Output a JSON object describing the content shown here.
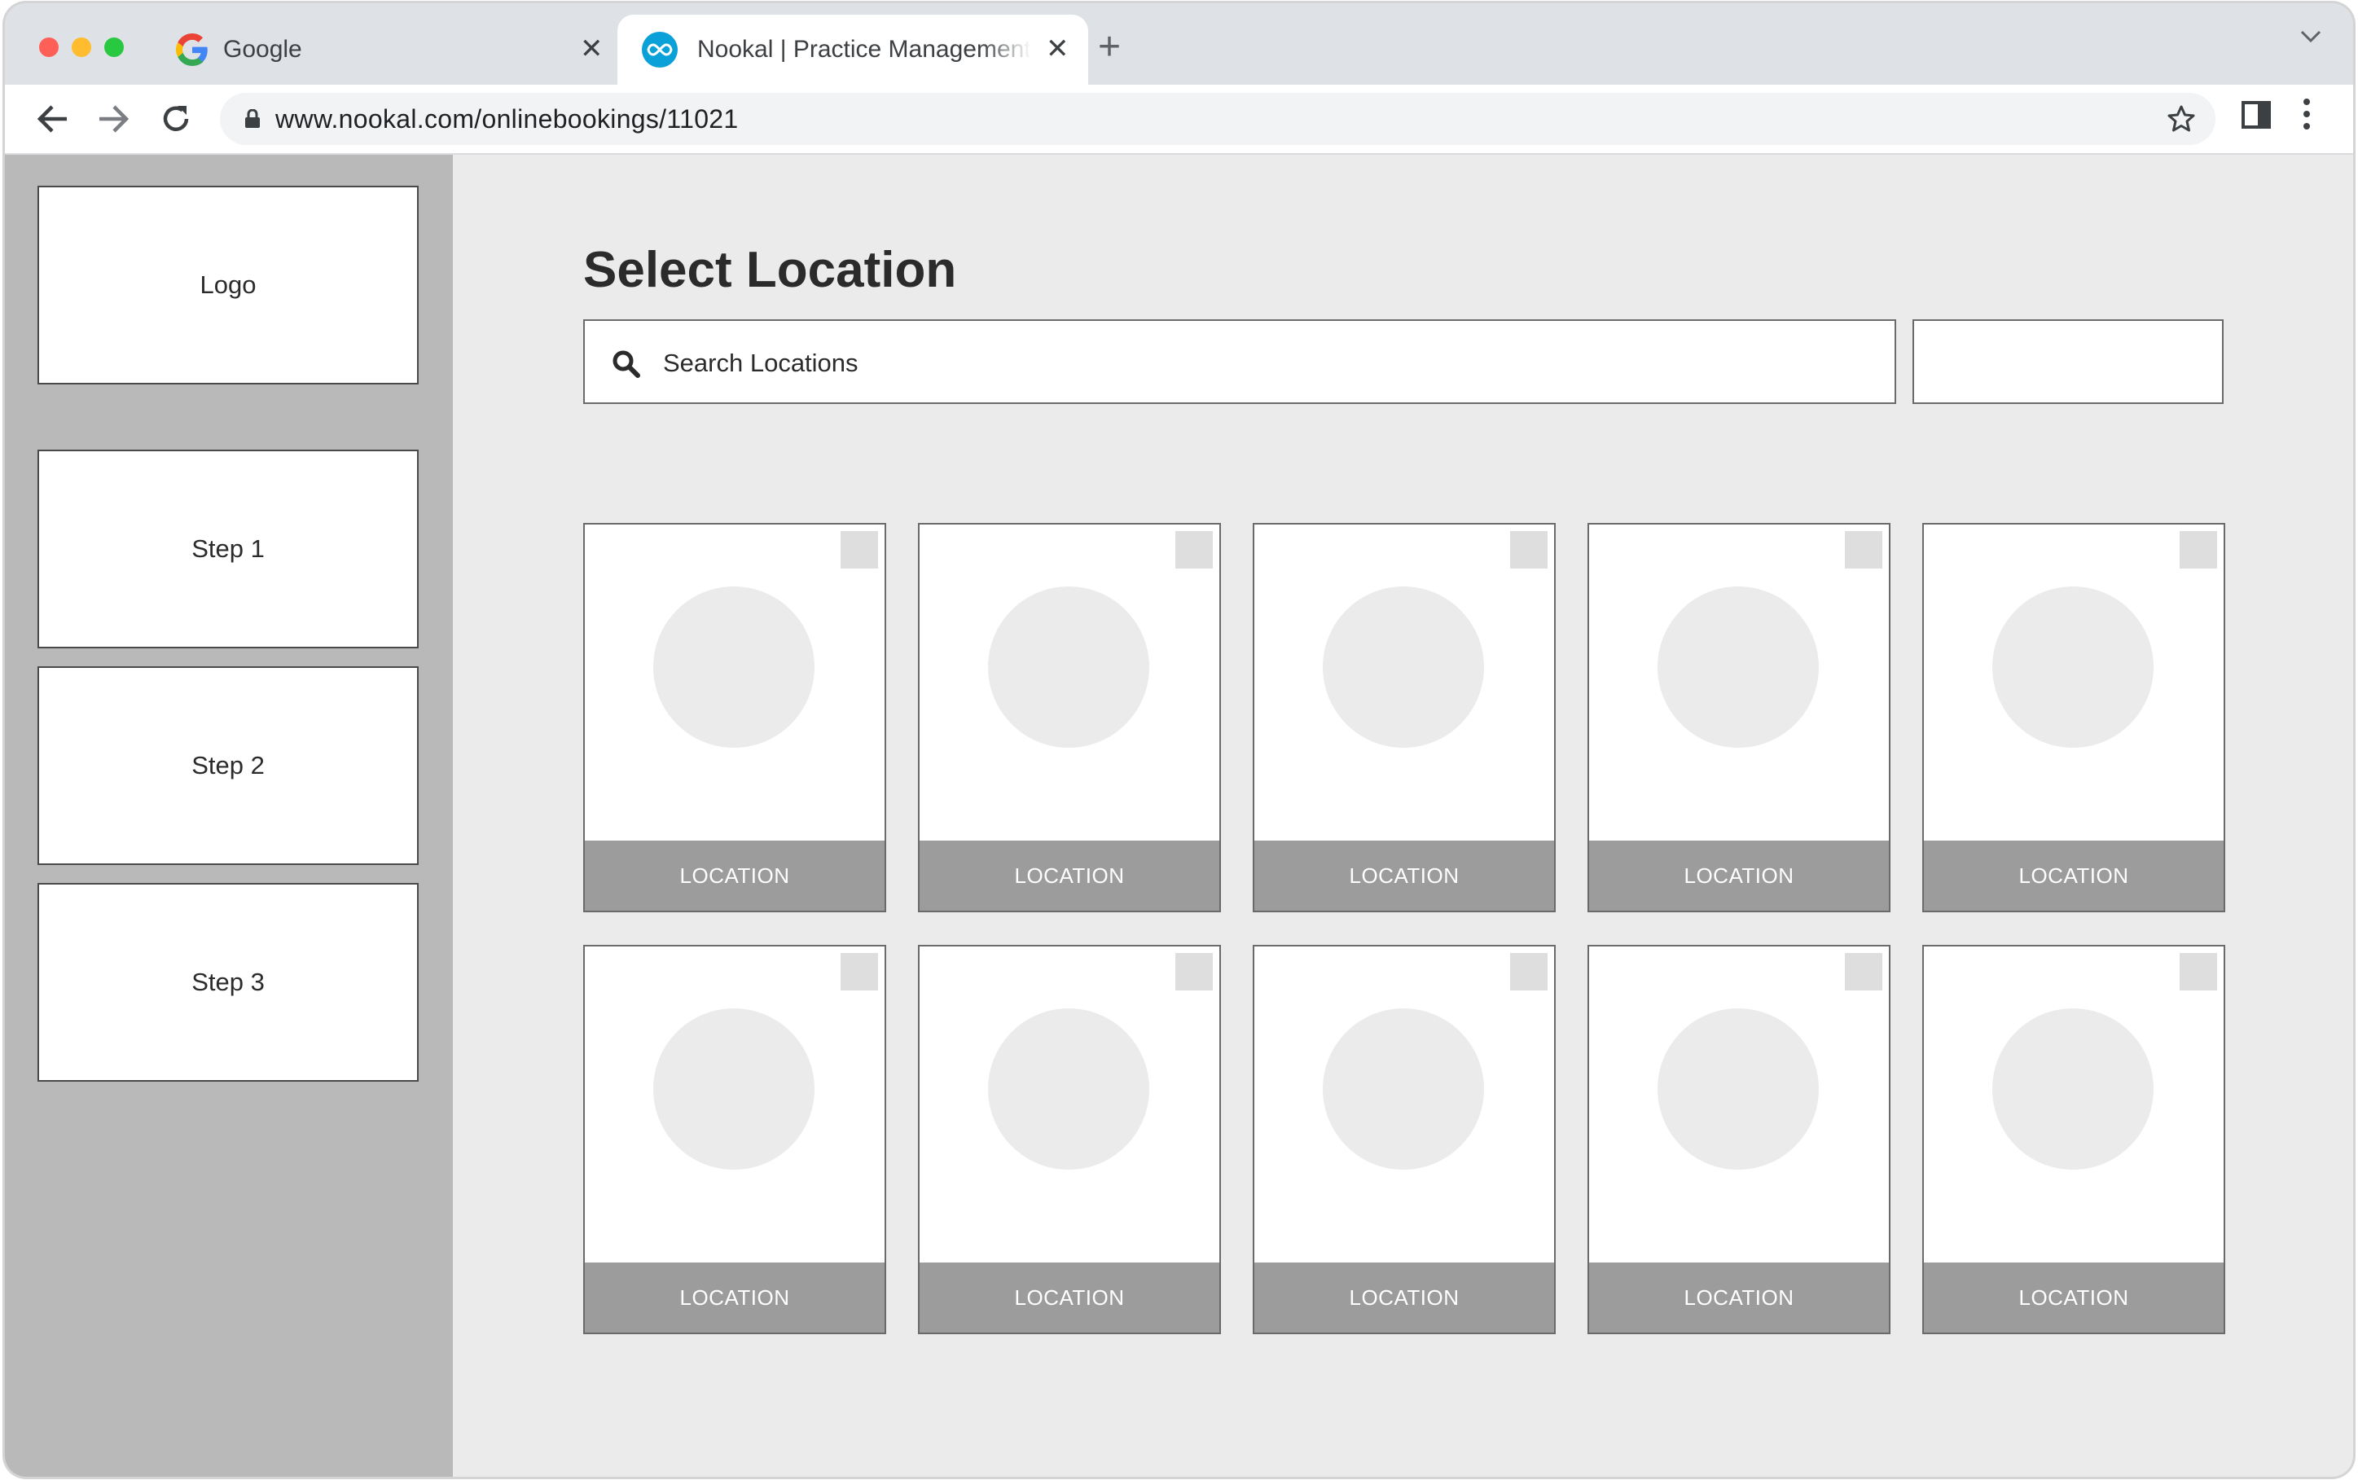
{
  "browser": {
    "tabs": [
      {
        "title": "Google",
        "active": false,
        "icon": "google-icon"
      },
      {
        "title": "Nookal | Practice Management",
        "active": true,
        "icon": "nookal-icon"
      }
    ],
    "url": "www.nookal.com/onlinebookings/11021"
  },
  "sidebar": {
    "logo": "Logo",
    "steps": [
      "Step 1",
      "Step 2",
      "Step 3"
    ]
  },
  "main": {
    "title": "Select Location",
    "search": {
      "placeholder": "Search Locations"
    },
    "filter": {
      "value": ""
    },
    "locations": [
      {
        "label": "LOCATION"
      },
      {
        "label": "LOCATION"
      },
      {
        "label": "LOCATION"
      },
      {
        "label": "LOCATION"
      },
      {
        "label": "LOCATION"
      },
      {
        "label": "LOCATION"
      },
      {
        "label": "LOCATION"
      },
      {
        "label": "LOCATION"
      },
      {
        "label": "LOCATION"
      },
      {
        "label": "LOCATION"
      }
    ]
  },
  "colors": {
    "sidebar": "#b9b9b9",
    "content_bg": "#ebebeb",
    "card_footer": "#9c9c9c",
    "nookal_brand": "#0aa0d8"
  }
}
